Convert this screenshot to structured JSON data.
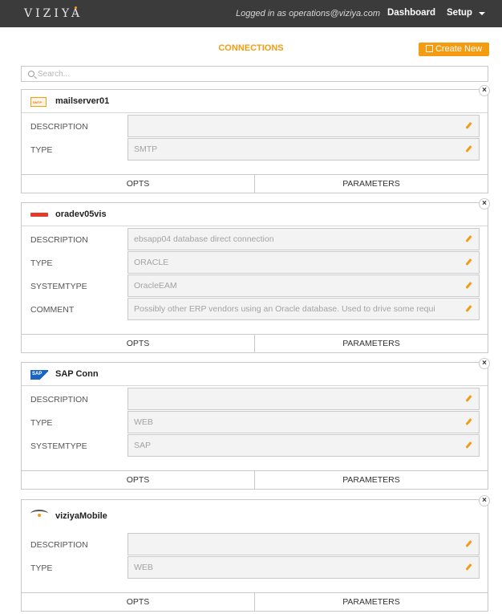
{
  "header": {
    "logo": "VIZIYA",
    "logged_in": "Logged in as operations@viziya.com",
    "dashboard": "Dashboard",
    "setup": "Setup"
  },
  "page": {
    "title": "CONNECTIONS",
    "create_new": "Create New",
    "search_placeholder": "Search..."
  },
  "connections": [
    {
      "name": "mailserver01",
      "icon": "smtp-icon",
      "fields": [
        {
          "label": "DESCRIPTION",
          "value": ""
        },
        {
          "label": "TYPE",
          "value": "SMTP"
        }
      ],
      "opts": "OPTS",
      "params": "PARAMETERS"
    },
    {
      "name": "oradev05vis",
      "icon": "oracle-icon",
      "fields": [
        {
          "label": "DESCRIPTION",
          "value": "ebsapp04 database direct connection"
        },
        {
          "label": "TYPE",
          "value": "ORACLE"
        },
        {
          "label": "SYSTEMTYPE",
          "value": "OracleEAM"
        },
        {
          "label": "COMMENT",
          "value": "Possibly other ERP vendors using an Oracle database. Used to drive some requi"
        }
      ],
      "opts": "OPTS",
      "params": "PARAMETERS"
    },
    {
      "name": "SAP Conn",
      "icon": "sap-icon",
      "fields": [
        {
          "label": "DESCRIPTION",
          "value": ""
        },
        {
          "label": "TYPE",
          "value": "WEB"
        },
        {
          "label": "SYSTEMTYPE",
          "value": "SAP"
        }
      ],
      "opts": "OPTS",
      "params": "PARAMETERS"
    },
    {
      "name": "viziyaMobile",
      "icon": "viziya-icon",
      "fields": [
        {
          "label": "DESCRIPTION",
          "value": ""
        },
        {
          "label": "TYPE",
          "value": "WEB"
        }
      ],
      "opts": "OPTS",
      "params": "PARAMETERS"
    }
  ],
  "colors": {
    "accent": "#f39c12",
    "navbar": "#3b3b3b"
  }
}
